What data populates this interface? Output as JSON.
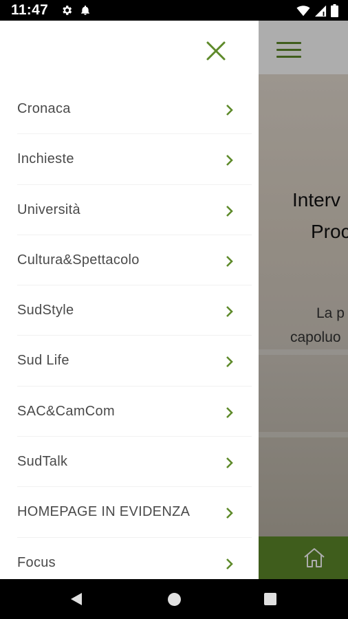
{
  "status_bar": {
    "time": "11:47",
    "left_icons": [
      "gear-icon",
      "notification-bell-icon"
    ],
    "right_icons": [
      "wifi-icon",
      "cell-signal-icon",
      "battery-icon"
    ]
  },
  "background_screen": {
    "title_line1": "Interv",
    "title_line2": "Proc",
    "subtitle_line1": "La p",
    "subtitle_line2": "capoluo",
    "accent_color": "#5e8a2a"
  },
  "drawer": {
    "close_icon": "close-icon",
    "items": [
      {
        "label": "Cronaca"
      },
      {
        "label": "Inchieste"
      },
      {
        "label": "Università"
      },
      {
        "label": "Cultura&Spettacolo"
      },
      {
        "label": "SudStyle"
      },
      {
        "label": "Sud Life"
      },
      {
        "label": "SAC&CamCom"
      },
      {
        "label": "SudTalk"
      },
      {
        "label": "HOMEPAGE IN EVIDENZA"
      },
      {
        "label": "Focus"
      }
    ]
  },
  "nav_bar": {
    "buttons": [
      "back-icon",
      "home-circle-icon",
      "recents-square-icon"
    ]
  }
}
